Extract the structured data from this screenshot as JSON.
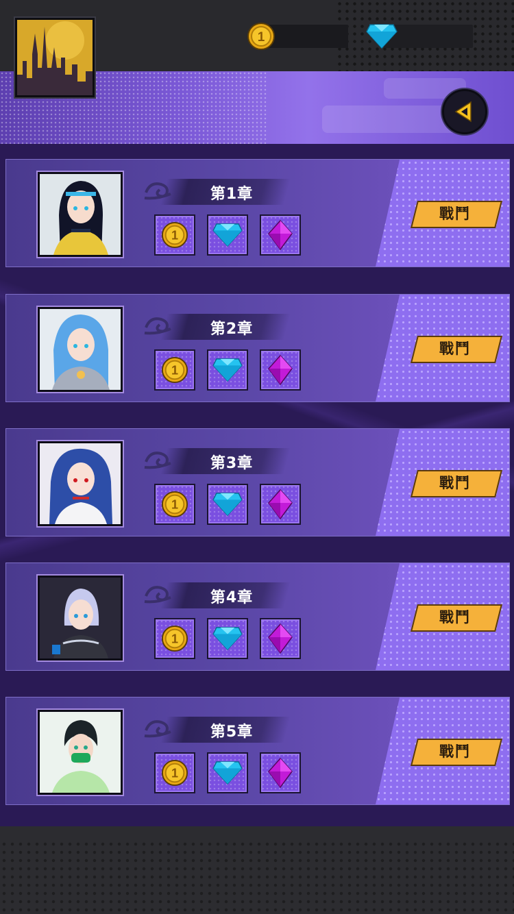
{
  "header": {
    "coins_value": "",
    "gems_value": "",
    "back_icon": "back-arrow-icon",
    "profile_icon": "castle-avatar"
  },
  "chapters": [
    {
      "title": "第1章",
      "button": "戰鬥",
      "rewards": [
        "coin-icon",
        "blue-gem-icon",
        "purple-gem-icon"
      ]
    },
    {
      "title": "第2章",
      "button": "戰鬥",
      "rewards": [
        "coin-icon",
        "blue-gem-icon",
        "purple-gem-icon"
      ]
    },
    {
      "title": "第3章",
      "button": "戰鬥",
      "rewards": [
        "coin-icon",
        "blue-gem-icon",
        "purple-gem-icon"
      ]
    },
    {
      "title": "第4章",
      "button": "戰鬥",
      "rewards": [
        "coin-icon",
        "blue-gem-icon",
        "purple-gem-icon"
      ]
    },
    {
      "title": "第5章",
      "button": "戰鬥",
      "rewards": [
        "coin-icon",
        "blue-gem-icon",
        "purple-gem-icon"
      ]
    }
  ],
  "colors": {
    "accent": "#f5b13a",
    "card": "#5a47a6",
    "panel": "#8e6ef0",
    "background": "#2a1a55"
  }
}
